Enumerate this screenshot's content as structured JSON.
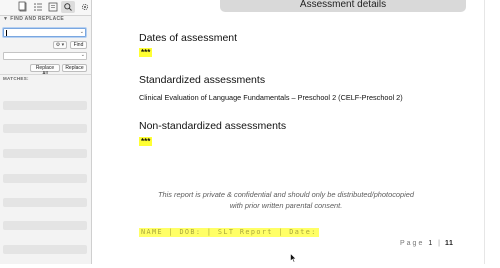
{
  "sidebar": {
    "tabs": [
      {
        "name": "tab-document"
      },
      {
        "name": "tab-outline"
      },
      {
        "name": "tab-bookmarks"
      },
      {
        "name": "tab-search"
      },
      {
        "name": "tab-settings"
      }
    ],
    "find_replace": {
      "title": "FIND AND REPLACE",
      "find_value": "",
      "options_label": "⚙ ▾",
      "find_button": "Find",
      "replace_value": "",
      "replace_all_button": "Replace All",
      "replace_button": "Replace"
    },
    "matches_label": "MATCHES:"
  },
  "document": {
    "header_title": "Assessment details",
    "dates_heading": "Dates of assessment",
    "dates_value": "***",
    "std_heading": "Standardized assessments",
    "std_text": "Clinical Evaluation of Language Fundamentals – Preschool 2 (CELF-Preschool 2)",
    "nonstd_heading": "Non-standardized assessments",
    "nonstd_value": "***",
    "disclaimer_line1": "This report is private & confidential and should only be distributed/photocopied",
    "disclaimer_line2": "with prior written parental consent.",
    "footer_text": "NAME | DOB: | SLT Report | Date:",
    "page_label": "Page",
    "page_current": "1",
    "page_sep": "|",
    "page_total": "11"
  },
  "colors": {
    "highlight": "#ffff33",
    "focus": "#7aa7e0"
  }
}
